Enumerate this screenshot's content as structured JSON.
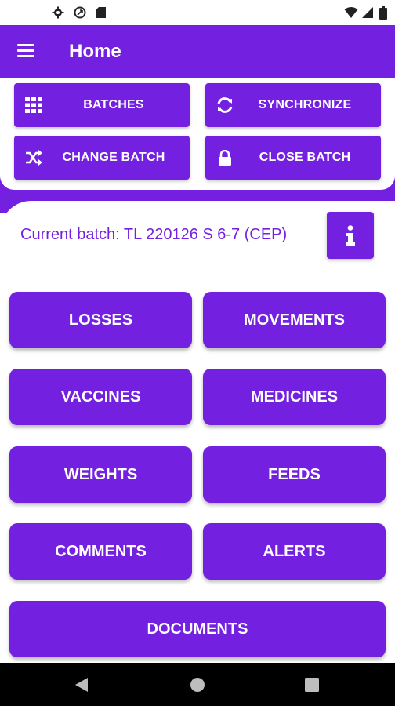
{
  "status_bar": {
    "icons": [
      "settings-icon",
      "sync-icon",
      "sd-card-icon",
      "wifi-icon",
      "signal-icon",
      "battery-icon"
    ],
    "background": "#ffffff"
  },
  "app_bar": {
    "title": "Home",
    "menu_icon": "menu-icon",
    "color": "#7320e0"
  },
  "top_actions": [
    {
      "label": "BATCHES",
      "icon": "grid-icon"
    },
    {
      "label": "SYNCHRONIZE",
      "icon": "refresh-icon"
    },
    {
      "label": "CHANGE BATCH",
      "icon": "shuffle-icon"
    },
    {
      "label": "CLOSE BATCH",
      "icon": "lock-icon"
    }
  ],
  "current_batch": {
    "text": "Current batch: TL 220126 S 6-7 (CEP)",
    "info_icon": "info-icon"
  },
  "menu_buttons": [
    "LOSSES",
    "MOVEMENTS",
    "VACCINES",
    "MEDICINES",
    "WEIGHTS",
    "FEEDS",
    "COMMENTS",
    "ALERTS",
    "DOCUMENTS"
  ],
  "nav_bar": {
    "icons": [
      "back-icon",
      "home-icon",
      "recents-icon"
    ]
  }
}
